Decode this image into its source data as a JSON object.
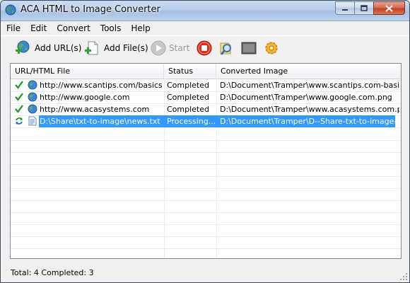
{
  "window": {
    "title": "ACA HTML to Image Converter"
  },
  "menu": {
    "items": [
      "File",
      "Edit",
      "Convert",
      "Tools",
      "Help"
    ]
  },
  "toolbar": {
    "add_url_label": "Add URL(s)",
    "add_file_label": "Add File(s)",
    "start_label": "Start",
    "start_icon": "play-icon",
    "stop_icon": "stop-icon",
    "search_icon": "search-icon",
    "window_icon": "window-icon",
    "settings_icon": "gear-icon"
  },
  "list": {
    "columns": [
      "URL/HTML File",
      "Status",
      "Converted Image"
    ],
    "rows": [
      {
        "source": "http://www.scantips.com/basics...",
        "status": "Completed",
        "output": "D:\\Document\\Tramper\\www.scantips.com-basic...",
        "state": "done"
      },
      {
        "source": "http://www.google.com",
        "status": "Completed",
        "output": "D:\\Document\\Tramper\\www.google.com.png",
        "state": "done"
      },
      {
        "source": "http://www.acasystems.com",
        "status": "Completed",
        "output": "D:\\Document\\Tramper\\www.acasystems.com.png",
        "state": "done"
      },
      {
        "source": "D:\\Share\\txt-to-image\\news.txt",
        "status": "Processing...",
        "output": "D:\\Document\\Tramper\\D--Share-txt-to-image-n...",
        "state": "processing"
      }
    ]
  },
  "statusbar": {
    "text": "Total: 4  Completed: 3"
  },
  "colors": {
    "selection": "#3399ff",
    "check": "#1a9a1a",
    "stop": "#e02818"
  }
}
